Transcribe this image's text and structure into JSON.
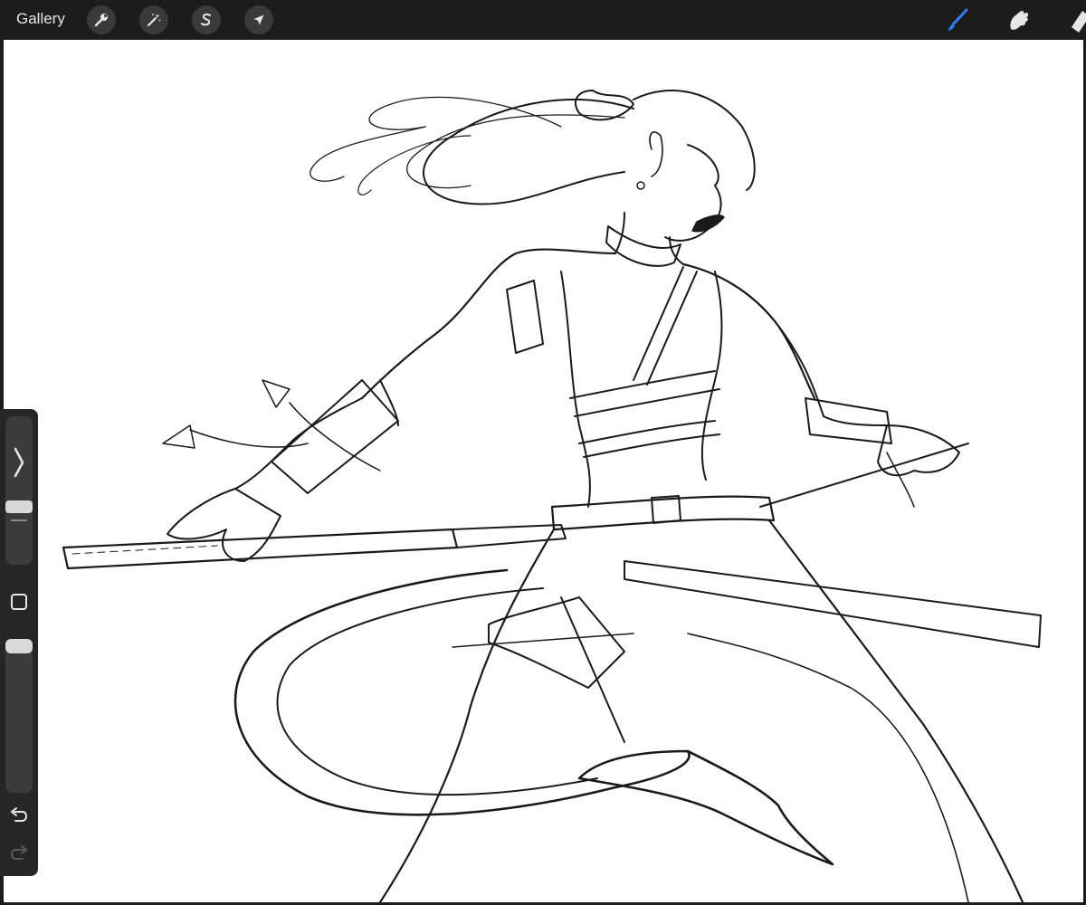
{
  "topbar": {
    "gallery_label": "Gallery",
    "left_tools": [
      {
        "name": "actions",
        "icon": "wrench-icon"
      },
      {
        "name": "adjustments",
        "icon": "magic-wand-icon"
      },
      {
        "name": "selection",
        "icon": "selection-s-icon"
      },
      {
        "name": "transform",
        "icon": "arrow-cursor-icon"
      }
    ],
    "right_tools": [
      {
        "name": "brush",
        "icon": "brush-icon",
        "active": true
      },
      {
        "name": "smudge",
        "icon": "smudge-finger-icon",
        "active": false
      },
      {
        "name": "eraser",
        "icon": "eraser-icon",
        "active": false
      }
    ]
  },
  "canvas": {
    "content": "line-art-drawing",
    "background": "#ffffff"
  },
  "sidebar": {
    "expand_icon": "chevron-right-icon",
    "brush_size_level": 0.1,
    "opacity_level": 0.0,
    "modify_icon": "square-icon",
    "undo_icon": "undo-icon",
    "redo_icon": "redo-icon"
  },
  "colors": {
    "accent": "#2f7cf6",
    "toolbar_bg": "#1c1c1c",
    "button_bg": "#3a3a3a"
  }
}
